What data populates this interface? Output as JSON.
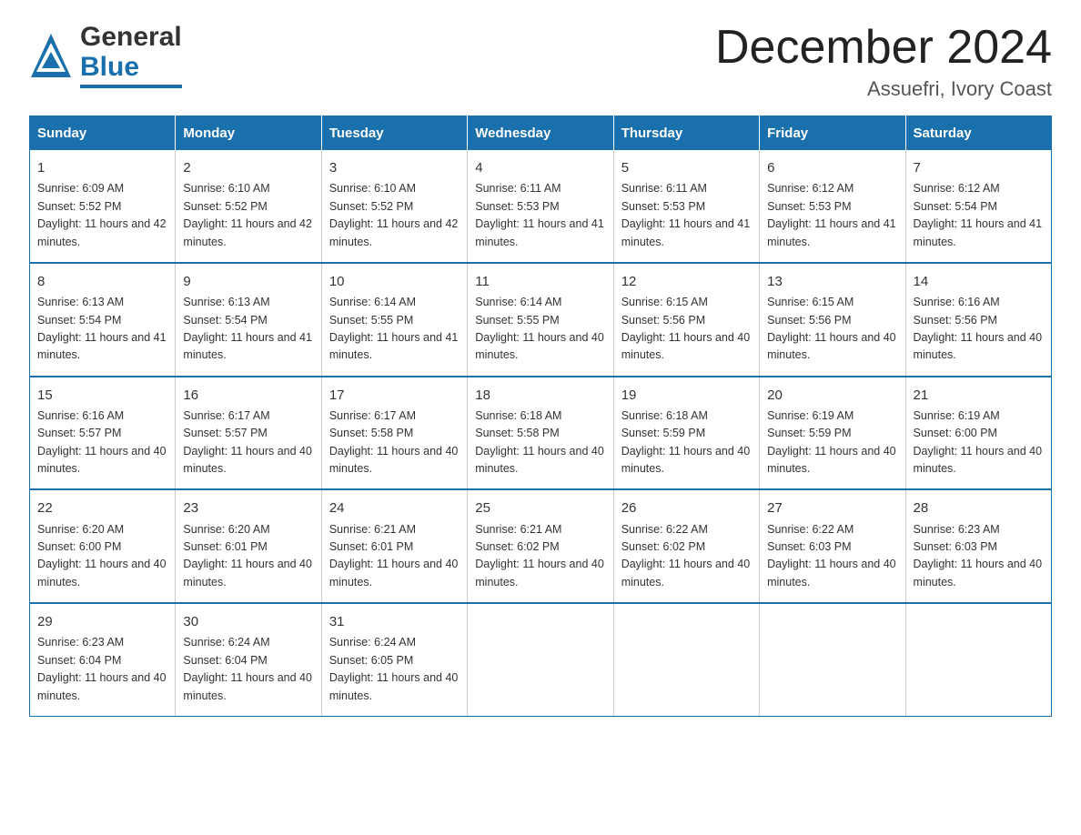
{
  "header": {
    "logo_general": "General",
    "logo_blue": "Blue",
    "title": "December 2024",
    "subtitle": "Assuefri, Ivory Coast"
  },
  "days_of_week": [
    "Sunday",
    "Monday",
    "Tuesday",
    "Wednesday",
    "Thursday",
    "Friday",
    "Saturday"
  ],
  "weeks": [
    [
      {
        "day": "1",
        "sunrise": "Sunrise: 6:09 AM",
        "sunset": "Sunset: 5:52 PM",
        "daylight": "Daylight: 11 hours and 42 minutes."
      },
      {
        "day": "2",
        "sunrise": "Sunrise: 6:10 AM",
        "sunset": "Sunset: 5:52 PM",
        "daylight": "Daylight: 11 hours and 42 minutes."
      },
      {
        "day": "3",
        "sunrise": "Sunrise: 6:10 AM",
        "sunset": "Sunset: 5:52 PM",
        "daylight": "Daylight: 11 hours and 42 minutes."
      },
      {
        "day": "4",
        "sunrise": "Sunrise: 6:11 AM",
        "sunset": "Sunset: 5:53 PM",
        "daylight": "Daylight: 11 hours and 41 minutes."
      },
      {
        "day": "5",
        "sunrise": "Sunrise: 6:11 AM",
        "sunset": "Sunset: 5:53 PM",
        "daylight": "Daylight: 11 hours and 41 minutes."
      },
      {
        "day": "6",
        "sunrise": "Sunrise: 6:12 AM",
        "sunset": "Sunset: 5:53 PM",
        "daylight": "Daylight: 11 hours and 41 minutes."
      },
      {
        "day": "7",
        "sunrise": "Sunrise: 6:12 AM",
        "sunset": "Sunset: 5:54 PM",
        "daylight": "Daylight: 11 hours and 41 minutes."
      }
    ],
    [
      {
        "day": "8",
        "sunrise": "Sunrise: 6:13 AM",
        "sunset": "Sunset: 5:54 PM",
        "daylight": "Daylight: 11 hours and 41 minutes."
      },
      {
        "day": "9",
        "sunrise": "Sunrise: 6:13 AM",
        "sunset": "Sunset: 5:54 PM",
        "daylight": "Daylight: 11 hours and 41 minutes."
      },
      {
        "day": "10",
        "sunrise": "Sunrise: 6:14 AM",
        "sunset": "Sunset: 5:55 PM",
        "daylight": "Daylight: 11 hours and 41 minutes."
      },
      {
        "day": "11",
        "sunrise": "Sunrise: 6:14 AM",
        "sunset": "Sunset: 5:55 PM",
        "daylight": "Daylight: 11 hours and 40 minutes."
      },
      {
        "day": "12",
        "sunrise": "Sunrise: 6:15 AM",
        "sunset": "Sunset: 5:56 PM",
        "daylight": "Daylight: 11 hours and 40 minutes."
      },
      {
        "day": "13",
        "sunrise": "Sunrise: 6:15 AM",
        "sunset": "Sunset: 5:56 PM",
        "daylight": "Daylight: 11 hours and 40 minutes."
      },
      {
        "day": "14",
        "sunrise": "Sunrise: 6:16 AM",
        "sunset": "Sunset: 5:56 PM",
        "daylight": "Daylight: 11 hours and 40 minutes."
      }
    ],
    [
      {
        "day": "15",
        "sunrise": "Sunrise: 6:16 AM",
        "sunset": "Sunset: 5:57 PM",
        "daylight": "Daylight: 11 hours and 40 minutes."
      },
      {
        "day": "16",
        "sunrise": "Sunrise: 6:17 AM",
        "sunset": "Sunset: 5:57 PM",
        "daylight": "Daylight: 11 hours and 40 minutes."
      },
      {
        "day": "17",
        "sunrise": "Sunrise: 6:17 AM",
        "sunset": "Sunset: 5:58 PM",
        "daylight": "Daylight: 11 hours and 40 minutes."
      },
      {
        "day": "18",
        "sunrise": "Sunrise: 6:18 AM",
        "sunset": "Sunset: 5:58 PM",
        "daylight": "Daylight: 11 hours and 40 minutes."
      },
      {
        "day": "19",
        "sunrise": "Sunrise: 6:18 AM",
        "sunset": "Sunset: 5:59 PM",
        "daylight": "Daylight: 11 hours and 40 minutes."
      },
      {
        "day": "20",
        "sunrise": "Sunrise: 6:19 AM",
        "sunset": "Sunset: 5:59 PM",
        "daylight": "Daylight: 11 hours and 40 minutes."
      },
      {
        "day": "21",
        "sunrise": "Sunrise: 6:19 AM",
        "sunset": "Sunset: 6:00 PM",
        "daylight": "Daylight: 11 hours and 40 minutes."
      }
    ],
    [
      {
        "day": "22",
        "sunrise": "Sunrise: 6:20 AM",
        "sunset": "Sunset: 6:00 PM",
        "daylight": "Daylight: 11 hours and 40 minutes."
      },
      {
        "day": "23",
        "sunrise": "Sunrise: 6:20 AM",
        "sunset": "Sunset: 6:01 PM",
        "daylight": "Daylight: 11 hours and 40 minutes."
      },
      {
        "day": "24",
        "sunrise": "Sunrise: 6:21 AM",
        "sunset": "Sunset: 6:01 PM",
        "daylight": "Daylight: 11 hours and 40 minutes."
      },
      {
        "day": "25",
        "sunrise": "Sunrise: 6:21 AM",
        "sunset": "Sunset: 6:02 PM",
        "daylight": "Daylight: 11 hours and 40 minutes."
      },
      {
        "day": "26",
        "sunrise": "Sunrise: 6:22 AM",
        "sunset": "Sunset: 6:02 PM",
        "daylight": "Daylight: 11 hours and 40 minutes."
      },
      {
        "day": "27",
        "sunrise": "Sunrise: 6:22 AM",
        "sunset": "Sunset: 6:03 PM",
        "daylight": "Daylight: 11 hours and 40 minutes."
      },
      {
        "day": "28",
        "sunrise": "Sunrise: 6:23 AM",
        "sunset": "Sunset: 6:03 PM",
        "daylight": "Daylight: 11 hours and 40 minutes."
      }
    ],
    [
      {
        "day": "29",
        "sunrise": "Sunrise: 6:23 AM",
        "sunset": "Sunset: 6:04 PM",
        "daylight": "Daylight: 11 hours and 40 minutes."
      },
      {
        "day": "30",
        "sunrise": "Sunrise: 6:24 AM",
        "sunset": "Sunset: 6:04 PM",
        "daylight": "Daylight: 11 hours and 40 minutes."
      },
      {
        "day": "31",
        "sunrise": "Sunrise: 6:24 AM",
        "sunset": "Sunset: 6:05 PM",
        "daylight": "Daylight: 11 hours and 40 minutes."
      },
      {
        "day": "",
        "sunrise": "",
        "sunset": "",
        "daylight": ""
      },
      {
        "day": "",
        "sunrise": "",
        "sunset": "",
        "daylight": ""
      },
      {
        "day": "",
        "sunrise": "",
        "sunset": "",
        "daylight": ""
      },
      {
        "day": "",
        "sunrise": "",
        "sunset": "",
        "daylight": ""
      }
    ]
  ]
}
